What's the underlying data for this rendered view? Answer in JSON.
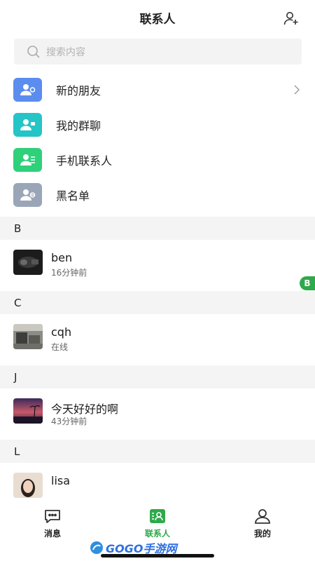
{
  "header": {
    "title": "联系人"
  },
  "search": {
    "placeholder": "搜索内容"
  },
  "menu": [
    {
      "label": "新的朋友",
      "icon": "add-friend-icon",
      "color": "#5b8def",
      "chevron": true
    },
    {
      "label": "我的群聊",
      "icon": "group-chat-icon",
      "color": "#25c4c7",
      "chevron": false
    },
    {
      "label": "手机联系人",
      "icon": "phone-contacts-icon",
      "color": "#2fd07a",
      "chevron": false
    },
    {
      "label": "黑名单",
      "icon": "blacklist-icon",
      "color": "#9aa6b8",
      "chevron": false
    }
  ],
  "sections": [
    {
      "letter": "B",
      "contacts": [
        {
          "name": "ben",
          "status": "16分钟前"
        }
      ]
    },
    {
      "letter": "C",
      "contacts": [
        {
          "name": "cqh",
          "status": "在线"
        }
      ]
    },
    {
      "letter": "J",
      "contacts": [
        {
          "name": "今天好好的啊",
          "status": "43分钟前"
        }
      ]
    },
    {
      "letter": "L",
      "contacts": [
        {
          "name": "lisa",
          "status": ""
        }
      ]
    }
  ],
  "index_badge": "B",
  "tabs": [
    {
      "label": "消息",
      "icon": "message-icon",
      "active": false
    },
    {
      "label": "联系人",
      "icon": "contacts-icon",
      "active": true
    },
    {
      "label": "我的",
      "icon": "profile-icon",
      "active": false
    }
  ],
  "watermark": {
    "text": "GOGO手游网"
  },
  "colors": {
    "accent": "#2ea94b",
    "section_bg": "#f4f4f4",
    "search_bg": "#f3f3f3"
  }
}
